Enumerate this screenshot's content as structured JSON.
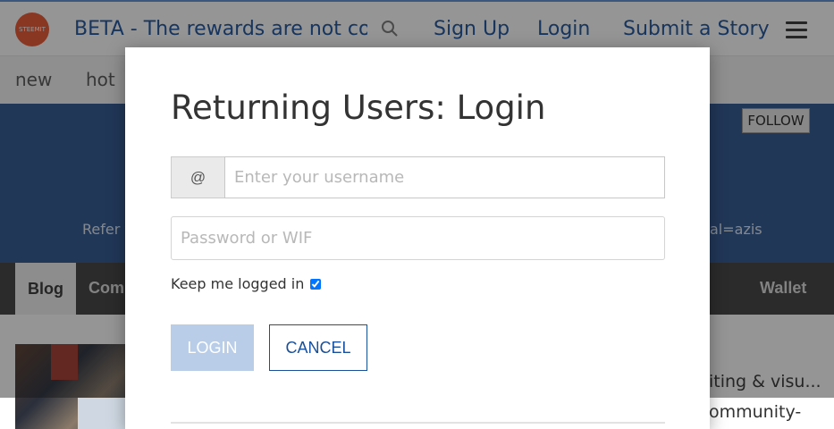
{
  "header": {
    "logo_text": "STEEMIT",
    "beta_banner": "BETA - The rewards are not correct",
    "signup_label": "Sign Up",
    "login_label": "Login",
    "submit_label": "Submit a Story"
  },
  "subnav": {
    "items": [
      {
        "label": "new"
      },
      {
        "label": "hot"
      }
    ]
  },
  "profile": {
    "follow_label": "FOLLOW",
    "banner_left": "Refer y",
    "banner_right": "al=azis"
  },
  "tabs": {
    "blog": "Blog",
    "comments": "Com",
    "wallet": "Wallet"
  },
  "feed": {
    "post_title_fragment": "iting & visu...",
    "post_line_fragment": "ommunity-"
  },
  "modal": {
    "title": "Returning Users: Login",
    "at_symbol": "@",
    "username_placeholder": "Enter your username",
    "password_placeholder": "Password or WIF",
    "keep_logged_in_label": "Keep me logged in",
    "keep_logged_in_checked": true,
    "login_button": "LOGIN",
    "cancel_button": "CANCEL"
  },
  "colors": {
    "accent": "#1a5099",
    "banner": "#2d5591",
    "login_disabled": "#b9cde8",
    "logo": "#e9552f"
  }
}
